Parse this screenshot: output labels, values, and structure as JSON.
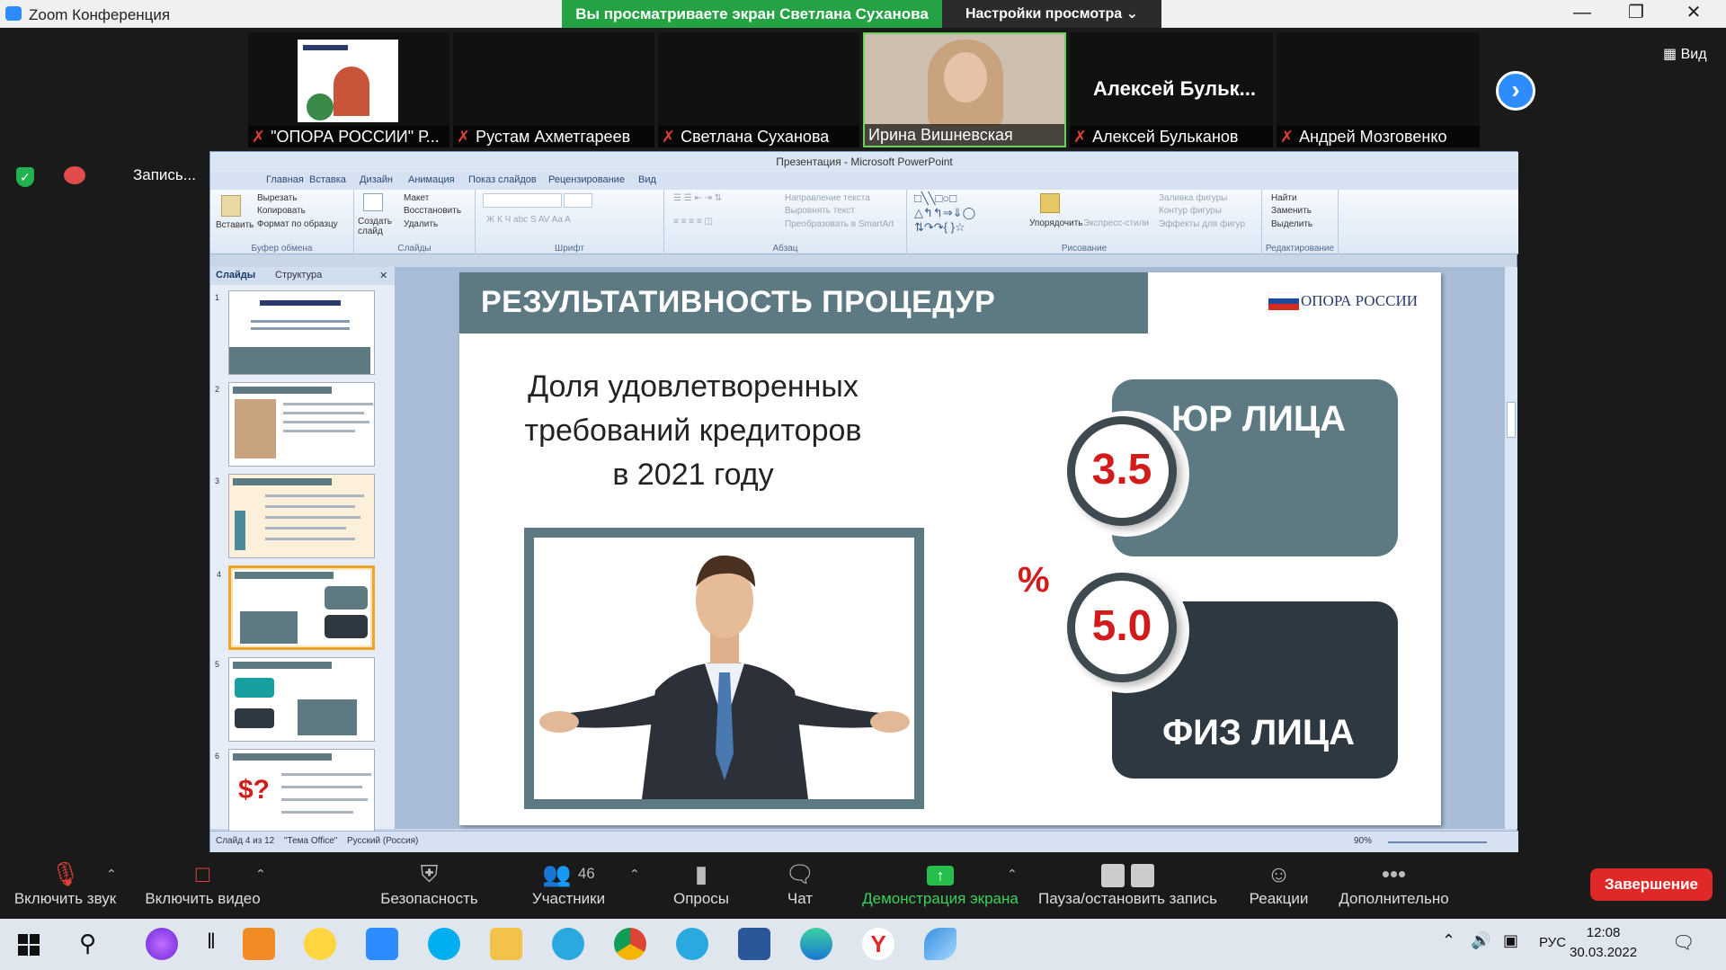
{
  "window": {
    "title": "Zoom Конференция",
    "share_banner": "Вы просматриваете экран Светлана Суханова",
    "view_settings": "Настройки просмотра",
    "view_button": "Вид"
  },
  "participants": [
    {
      "name": "\"ОПОРА РОССИИ\" Р...",
      "muted": true
    },
    {
      "name": "Рустам Ахметгареев",
      "muted": true
    },
    {
      "name": "Светлана Суханова",
      "muted": true
    },
    {
      "name": "Ирина Вишневская",
      "muted": false
    },
    {
      "name": "Алексей Бульканов",
      "muted": true,
      "big_label": "Алексей  Бульк..."
    },
    {
      "name": "Андрей Мозговенко",
      "muted": true
    }
  ],
  "recording": {
    "label": "Запись..."
  },
  "ppt": {
    "title": "Презентация - Microsoft PowerPoint",
    "tabs": [
      "Главная",
      "Вставка",
      "Дизайн",
      "Анимация",
      "Показ слайдов",
      "Рецензирование",
      "Вид"
    ],
    "clipboard": {
      "paste": "Вставить",
      "cut": "Вырезать",
      "copy": "Копировать",
      "format": "Формат по образцу",
      "label": "Буфер обмена"
    },
    "slides_group": {
      "new": "Создать слайд",
      "layout": "Макет",
      "reset": "Восстановить",
      "delete": "Удалить",
      "label": "Слайды"
    },
    "font_group": {
      "label": "Шрифт"
    },
    "paragraph_group": {
      "direction": "Направление текста",
      "align": "Выровнять текст",
      "smartart": "Преобразовать в SmartArt",
      "label": "Абзац"
    },
    "drawing_group": {
      "arrange": "Упорядочить",
      "styles": "Экспресс-стили",
      "fill": "Заливка фигуры",
      "outline": "Контур фигуры",
      "effects": "Эффекты для фигур",
      "label": "Рисование"
    },
    "editing_group": {
      "find": "Найти",
      "replace": "Заменить",
      "select": "Выделить",
      "label": "Редактирование"
    },
    "panel_tabs": [
      "Слайды",
      "Структура"
    ],
    "thumbs": [
      {
        "num": "1"
      },
      {
        "num": "2"
      },
      {
        "num": "3"
      },
      {
        "num": "4"
      },
      {
        "num": "5"
      },
      {
        "num": "6"
      }
    ],
    "status": {
      "slide": "Слайд 4 из 12",
      "theme": "\"Тема Office\"",
      "lang": "Русский (Россия)",
      "zoom": "90%"
    }
  },
  "slide": {
    "title": "РЕЗУЛЬТАТИВНОСТЬ ПРОЦЕДУР",
    "logo": "ОПОРА РОССИИ",
    "heading_line1": "Доля удовлетворенных",
    "heading_line2": "требований кредиторов",
    "heading_line3": "в 2021 году",
    "jur_label": "ЮР ЛИЦА",
    "jur_value": "3.5",
    "fiz_label": "ФИЗ ЛИЦА",
    "fiz_value": "5.0",
    "percent": "%"
  },
  "toolbar": {
    "audio": "Включить звук",
    "video": "Включить видео",
    "security": "Безопасность",
    "participants": "Участники",
    "participants_count": "46",
    "polls": "Опросы",
    "chat": "Чат",
    "share": "Демонстрация экрана",
    "record": "Пауза/остановить запись",
    "reactions": "Реакции",
    "more": "Дополнительно",
    "end": "Завершение"
  },
  "taskbar": {
    "lang": "РУС",
    "time": "12:08",
    "date": "30.03.2022"
  },
  "colors": {
    "slide_teal": "#5d7a83",
    "slide_dark": "#2e3840",
    "accent_red": "#d21c1c",
    "zoom_green": "#25a244",
    "zoom_blue": "#2d8cff"
  }
}
